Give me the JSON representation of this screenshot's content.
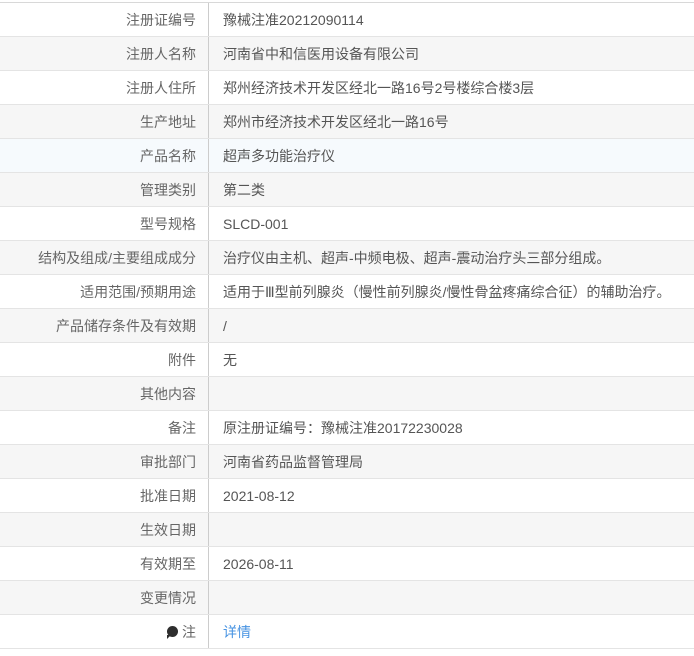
{
  "theme": {
    "link_color": "#4793e2",
    "stripe_color": "#f6f6f6",
    "highlight_color": "#f6fafd",
    "divider_color": "#cccccc",
    "label_color": "#666666",
    "value_color": "#555555"
  },
  "icons": {
    "note_icon": "note-balloon-icon"
  },
  "table": {
    "rows": [
      {
        "label": "注册证编号",
        "value": "豫械注准20212090114"
      },
      {
        "label": "注册人名称",
        "value": "河南省中和信医用设备有限公司"
      },
      {
        "label": "注册人住所",
        "value": "郑州经济技术开发区经北一路16号2号楼综合楼3层"
      },
      {
        "label": "生产地址",
        "value": "郑州市经济技术开发区经北一路16号"
      },
      {
        "label": "产品名称",
        "value": "超声多功能治疗仪",
        "highlight": true
      },
      {
        "label": "管理类别",
        "value": "第二类"
      },
      {
        "label": "型号规格",
        "value": "SLCD-001"
      },
      {
        "label": "结构及组成/主要组成成分",
        "value": "治疗仪由主机、超声-中频电极、超声-震动治疗头三部分组成。"
      },
      {
        "label": "适用范围/预期用途",
        "value": "适用于Ⅲ型前列腺炎（慢性前列腺炎/慢性骨盆疼痛综合征）的辅助治疗。"
      },
      {
        "label": "产品储存条件及有效期",
        "value": "/"
      },
      {
        "label": "附件",
        "value": "无"
      },
      {
        "label": "其他内容",
        "value": ""
      },
      {
        "label": "备注",
        "value": "原注册证编号：豫械注准20172230028"
      },
      {
        "label": "审批部门",
        "value": "河南省药品监督管理局"
      },
      {
        "label": "批准日期",
        "value": "2021-08-12"
      },
      {
        "label": "生效日期",
        "value": ""
      },
      {
        "label": "有效期至",
        "value": "2026-08-11"
      },
      {
        "label": "变更情况",
        "value": ""
      },
      {
        "label": "注",
        "value": "详情",
        "icon": true,
        "link": true
      }
    ]
  }
}
